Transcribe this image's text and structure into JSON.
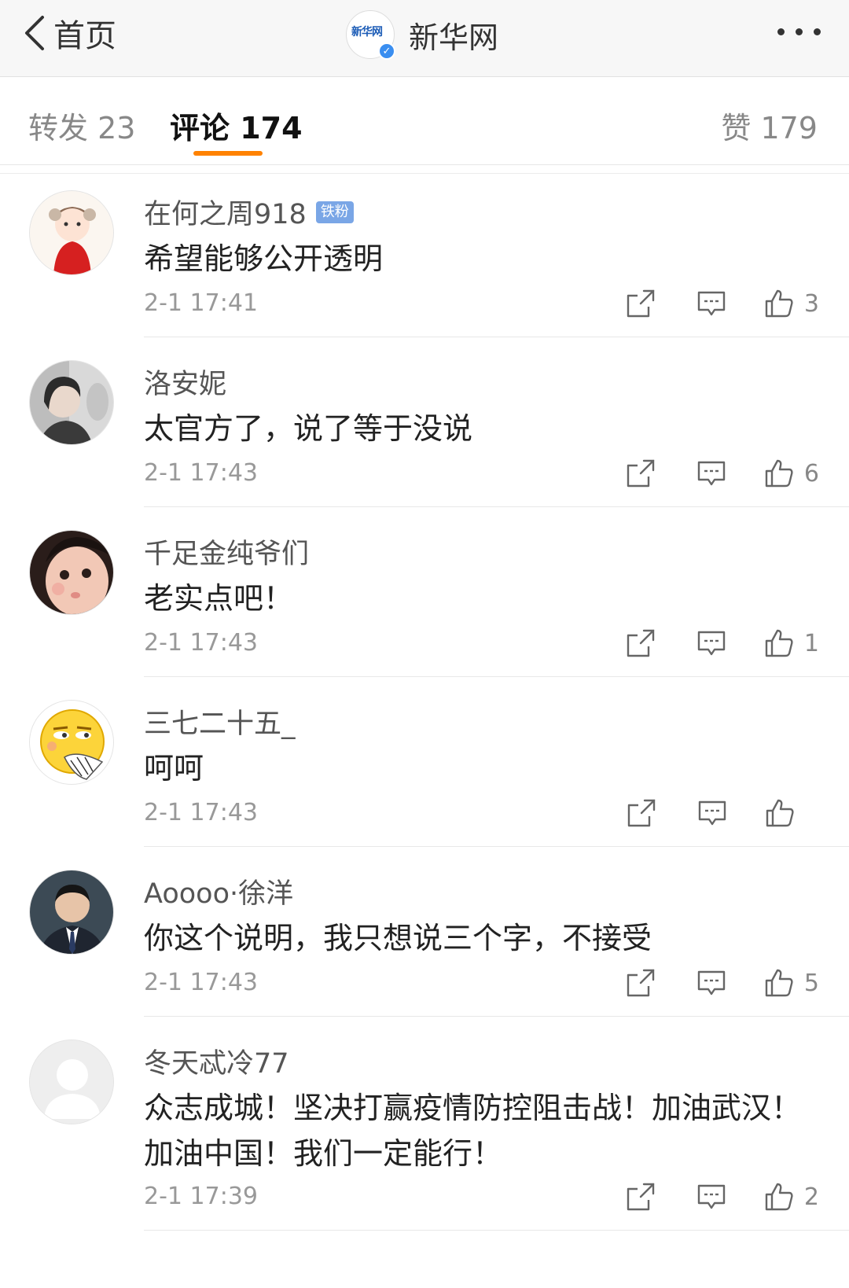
{
  "nav": {
    "back_label": "首页",
    "title": "新华网",
    "logo_text": "新华网"
  },
  "tabs": {
    "repost": "转发 23",
    "comments": "评论 174",
    "likes": "赞 179"
  },
  "colors": {
    "accent": "#ff8200",
    "badge": "#7aa6e6",
    "verified": "#3a8ef0"
  },
  "comments": [
    {
      "user": "在何之周918",
      "badge": "铁粉",
      "text": "希望能够公开透明",
      "time": "2-1 17:41",
      "likes": "3",
      "avatar": "girl-cartoon"
    },
    {
      "user": "洛安妮",
      "badge": "",
      "text": "太官方了，说了等于没说",
      "time": "2-1 17:43",
      "likes": "6",
      "avatar": "woman-photo"
    },
    {
      "user": "千足金纯爷们",
      "badge": "",
      "text": "老实点吧！",
      "time": "2-1 17:43",
      "likes": "1",
      "avatar": "baby-photo"
    },
    {
      "user": "三七二十五_",
      "badge": "",
      "text": "呵呵",
      "time": "2-1 17:43",
      "likes": "",
      "avatar": "emoji-face"
    },
    {
      "user": "Aoooo·徐洋",
      "badge": "",
      "text": "你这个说明，我只想说三个字，不接受",
      "time": "2-1 17:43",
      "likes": "5",
      "avatar": "man-suit-photo"
    },
    {
      "user": "冬天忒冷77",
      "badge": "",
      "text": "众志成城！坚决打赢疫情防控阻击战！加油武汉！加油中国！我们一定能行！",
      "time": "2-1 17:39",
      "likes": "2",
      "avatar": "default-avatar"
    }
  ]
}
